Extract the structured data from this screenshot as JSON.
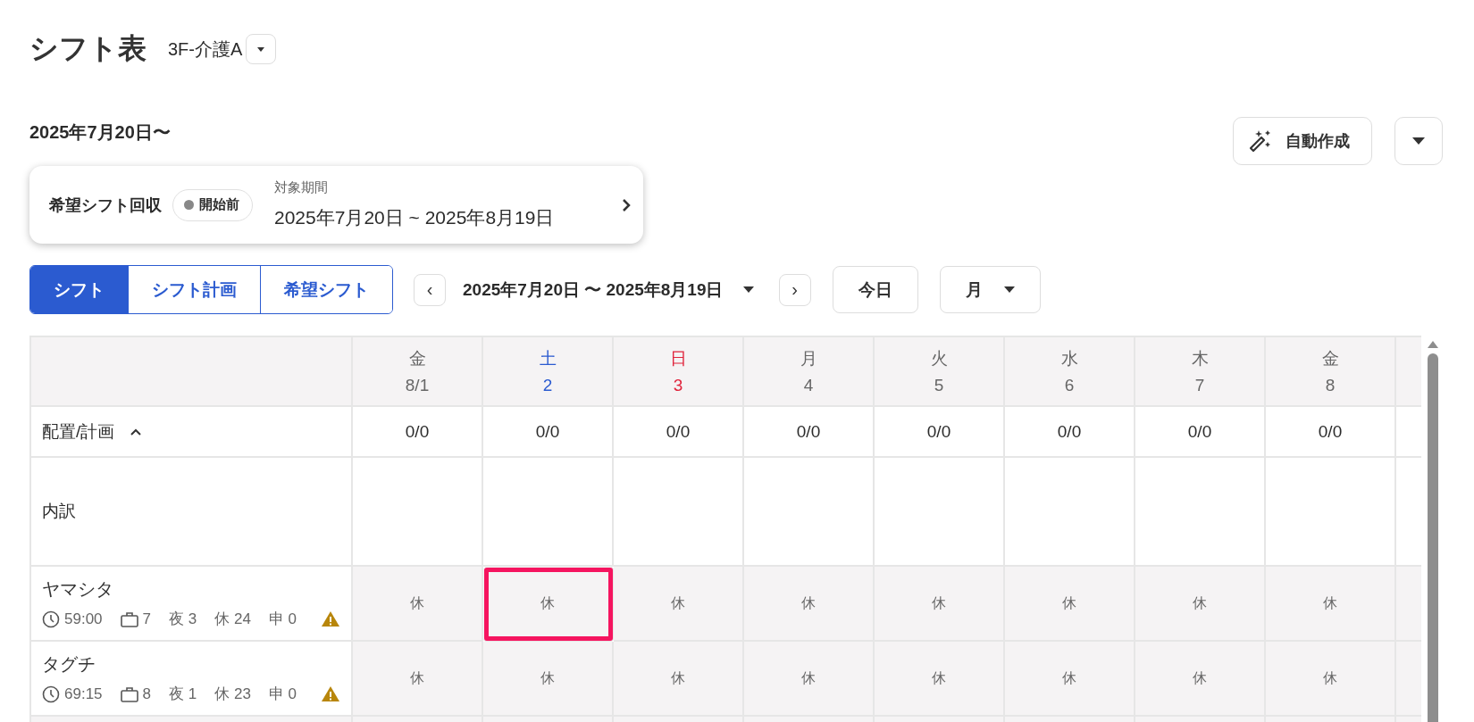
{
  "header": {
    "title": "シフト表",
    "unit": "3F-介護A"
  },
  "period_heading": "2025年7月20日〜",
  "actions": {
    "auto_create": "自動作成"
  },
  "collection_card": {
    "title": "希望シフト回収",
    "status": "開始前",
    "period_label": "対象期間",
    "period": "2025年7月20日 ~ 2025年8月19日"
  },
  "tabs": [
    {
      "label": "シフト",
      "selected": true
    },
    {
      "label": "シフト計画",
      "selected": false
    },
    {
      "label": "希望シフト",
      "selected": false
    }
  ],
  "range": {
    "prev": "‹",
    "label": "2025年7月20日 〜 2025年8月19日",
    "next": "›",
    "today": "今日",
    "view": "月"
  },
  "table": {
    "days": [
      {
        "weekday": "金",
        "date": "8/1",
        "kind": "weekday"
      },
      {
        "weekday": "土",
        "date": "2",
        "kind": "sat"
      },
      {
        "weekday": "日",
        "date": "3",
        "kind": "sun"
      },
      {
        "weekday": "月",
        "date": "4",
        "kind": "weekday"
      },
      {
        "weekday": "火",
        "date": "5",
        "kind": "weekday"
      },
      {
        "weekday": "水",
        "date": "6",
        "kind": "weekday"
      },
      {
        "weekday": "木",
        "date": "7",
        "kind": "weekday"
      },
      {
        "weekday": "金",
        "date": "8",
        "kind": "weekday"
      }
    ],
    "plan_row": {
      "label": "配置/計画",
      "expanded": true,
      "values": [
        "0/0",
        "0/0",
        "0/0",
        "0/0",
        "0/0",
        "0/0",
        "0/0",
        "0/0"
      ]
    },
    "breakdown_row": {
      "label": "内訳"
    },
    "staff": [
      {
        "name": "ヤマシタ",
        "warning": true,
        "stats": [
          {
            "kind": "clock",
            "text": "59:00"
          },
          {
            "kind": "bag",
            "text": "7"
          },
          {
            "kind": "plain",
            "text": "夜 3"
          },
          {
            "kind": "plain",
            "text": "休 24"
          },
          {
            "kind": "plain",
            "text": "申 0"
          }
        ],
        "cells": [
          {
            "text": "休",
            "selected": false
          },
          {
            "text": "休",
            "selected": true
          },
          {
            "text": "休",
            "selected": false
          },
          {
            "text": "休",
            "selected": false
          },
          {
            "text": "休",
            "selected": false
          },
          {
            "text": "休",
            "selected": false
          },
          {
            "text": "休",
            "selected": false
          },
          {
            "text": "休",
            "selected": false
          }
        ]
      },
      {
        "name": "タグチ",
        "warning": true,
        "stats": [
          {
            "kind": "clock",
            "text": "69:15"
          },
          {
            "kind": "bag",
            "text": "8"
          },
          {
            "kind": "plain",
            "text": "夜 1"
          },
          {
            "kind": "plain",
            "text": "休 23"
          },
          {
            "kind": "plain",
            "text": "申 0"
          }
        ],
        "cells": [
          {
            "text": "休",
            "selected": false
          },
          {
            "text": "休",
            "selected": false
          },
          {
            "text": "休",
            "selected": false
          },
          {
            "text": "休",
            "selected": false
          },
          {
            "text": "休",
            "selected": false
          },
          {
            "text": "休",
            "selected": false
          },
          {
            "text": "休",
            "selected": false
          },
          {
            "text": "休",
            "selected": false
          }
        ]
      }
    ]
  }
}
